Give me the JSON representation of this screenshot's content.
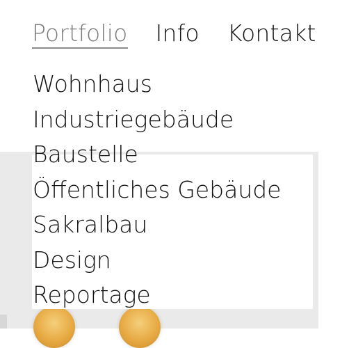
{
  "topnav": {
    "items": [
      {
        "label": "Portfolio",
        "active": true
      },
      {
        "label": "Info",
        "active": false
      },
      {
        "label": "Kontakt",
        "active": false
      }
    ]
  },
  "submenu": {
    "items": [
      {
        "label": "Wohnhaus"
      },
      {
        "label": "Industriegebäude"
      },
      {
        "label": "Baustelle"
      },
      {
        "label": "Öffentliches Gebäude"
      },
      {
        "label": "Sakralbau"
      },
      {
        "label": "Design"
      },
      {
        "label": "Reportage"
      }
    ]
  },
  "colors": {
    "text": "#111111",
    "active_text": "#7a7a7a",
    "underline": "#8a8a8a",
    "photo_bg": "#eaeaea",
    "lamp": "#e7aa43"
  }
}
